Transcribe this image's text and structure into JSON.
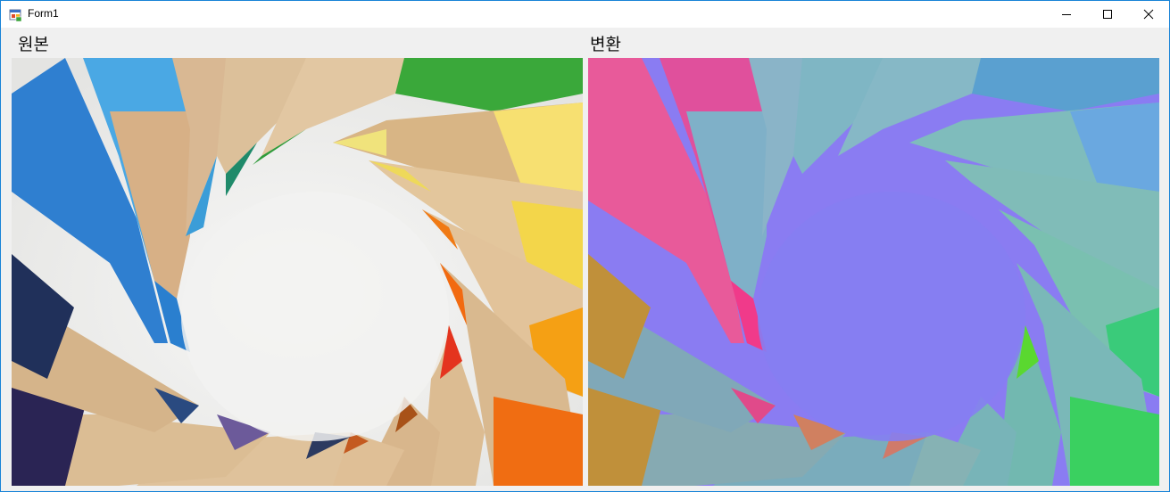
{
  "window": {
    "title": "Form1",
    "icon": "winforms-app-icon",
    "controls": [
      "minimize-icon",
      "maximize-icon",
      "close-icon"
    ],
    "accent_border": "#1883d7"
  },
  "panels": {
    "original": {
      "label": "원본",
      "image": "colored-pencils-circle-photo"
    },
    "converted": {
      "label": "변환",
      "image": "colored-pencils-circle-color-transformed"
    }
  }
}
